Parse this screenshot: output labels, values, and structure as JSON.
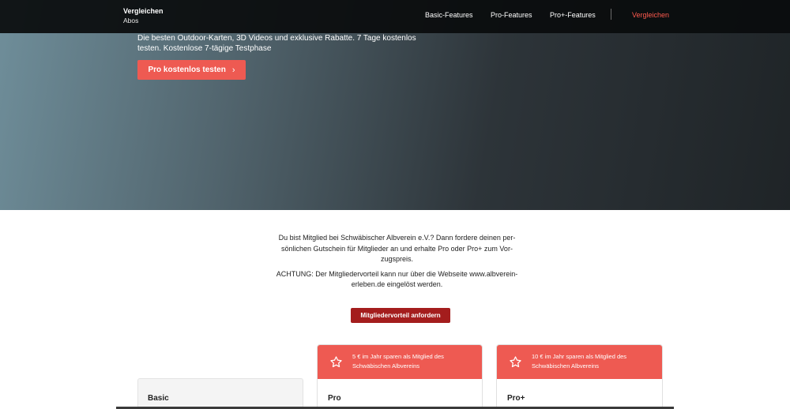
{
  "nav": {
    "brand_line1": "Vergleichen",
    "brand_line2": "Abos",
    "links": [
      "Basic-Features",
      "Pro-Features",
      "Pro+-Features"
    ],
    "active_link": "Vergleichen"
  },
  "hero": {
    "description": "Die besten Outdoor-Karten, 3D Videos und exklusive Rabatte. 7 Tage kostenlos testen. Kostenlose 7-tägige Testphase",
    "cta_label": "Pro kostenlos testen",
    "cta_icon": "chevron-right-icon"
  },
  "member": {
    "paragraph1": "Du bist Mitglied bei Schwäbischer Albverein e.V.? Dann fordere deinen per­sönlichen Gutschein für Mitglieder an und erhalte Pro oder Pro+ zum Vor­zugspreis.",
    "paragraph2": "ACHTUNG: Der Mitgliedervorteil kann nur über die Webseite www.albverein-erleben.de eingelöst werden.",
    "button_label": "Mitgliedervorteil anfordern"
  },
  "plans": [
    {
      "title": "Basic",
      "promo": ""
    },
    {
      "title": "Pro",
      "promo": "5 € im Jahr sparen als Mitglied des Schwäbischen Albvereins",
      "promo_icon": "star-icon"
    },
    {
      "title": "Pro+",
      "promo": "10 € im Jahr sparen als Mitglied des Schwäbischen Albvereins",
      "promo_icon": "star-icon"
    }
  ],
  "colors": {
    "accent": "#ee5a52",
    "nav_active": "#ff5a4e",
    "member_button": "#a41d1d"
  }
}
